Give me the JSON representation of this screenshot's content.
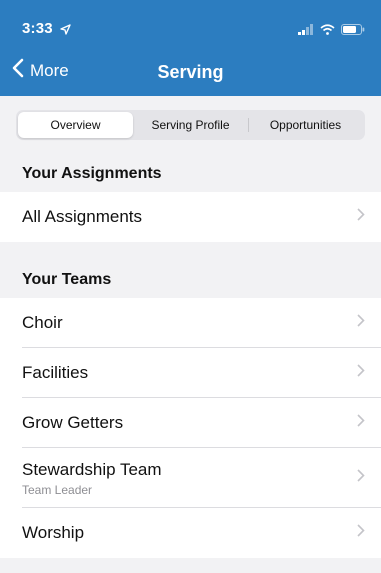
{
  "status_bar": {
    "time": "3:33"
  },
  "nav": {
    "back_label": "More",
    "title": "Serving"
  },
  "tabs": [
    {
      "label": "Overview",
      "active": true
    },
    {
      "label": "Serving Profile",
      "active": false
    },
    {
      "label": "Opportunities",
      "active": false
    }
  ],
  "assignments": {
    "header": "Your Assignments",
    "items": [
      {
        "label": "All Assignments"
      }
    ]
  },
  "teams": {
    "header": "Your Teams",
    "items": [
      {
        "label": "Choir"
      },
      {
        "label": "Facilities"
      },
      {
        "label": "Grow Getters"
      },
      {
        "label": "Stewardship Team",
        "subtitle": "Team Leader"
      },
      {
        "label": "Worship"
      }
    ]
  },
  "colors": {
    "nav_bar": "#2c7dc0",
    "background": "#f2f2f4",
    "chevron": "#c4c4c9"
  }
}
